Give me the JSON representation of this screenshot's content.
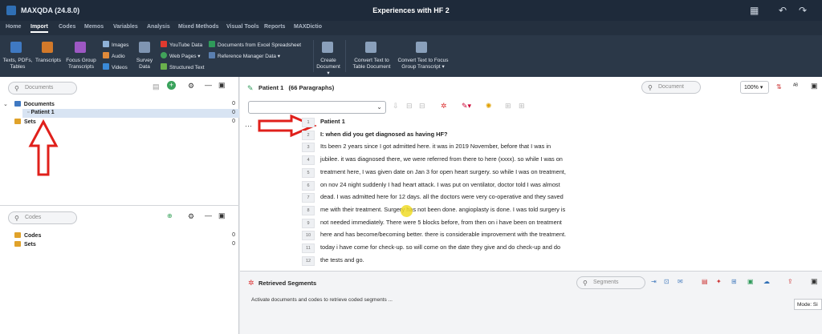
{
  "app": {
    "name": "MAXQDA (24.8.0)",
    "document_title": "Experiences with HF 2"
  },
  "tabs": [
    "Home",
    "Import",
    "Codes",
    "Memos",
    "Variables",
    "Analysis",
    "Mixed Methods",
    "Visual Tools",
    "Reports",
    "MAXDictio"
  ],
  "ribbon": {
    "texts": "Texts, PDFs,",
    "tables": "Tables",
    "transcripts": "Transcripts",
    "focus_group": "Focus Group",
    "focus_group2": "Transcripts",
    "images": "Images",
    "audio": "Audio",
    "videos": "Videos",
    "survey": "Survey",
    "survey2": "Data",
    "youtube": "YouTube Data",
    "webpages": "Web Pages",
    "structured": "Structured Text",
    "excel": "Documents from Excel Spreadsheet",
    "refman": "Reference Manager Data",
    "create_doc": "Create",
    "create_doc2": "Document",
    "convert_table": "Convert Text to",
    "convert_table2": "Table Document",
    "convert_focus": "Convert Text to Focus",
    "convert_focus2": "Group Transcript"
  },
  "documents_panel": {
    "search_placeholder": "Documents",
    "root_label": "Documents",
    "root_count": "0",
    "patient_label": "Patient 1",
    "patient_count": "0",
    "sets_label": "Sets",
    "sets_count": "0"
  },
  "codes_panel": {
    "search_placeholder": "Codes",
    "codes_label": "Codes",
    "codes_count": "0",
    "sets_label": "Sets",
    "sets_count": "0"
  },
  "document_browser": {
    "title": "Patient 1",
    "paragraphs": "(66 Paragraphs)",
    "search_placeholder": "Document",
    "zoom": "100%",
    "lines": [
      {
        "n": "1",
        "text": "Patient 1",
        "bold": true
      },
      {
        "n": "2",
        "text": "I: when did you get diagnosed as having HF?",
        "bold": true
      },
      {
        "n": "3",
        "text": "Its been 2 years since I got admitted here. it was in 2019 November, before that I was in"
      },
      {
        "n": "4",
        "text": "jubilee. it was diagnosed there, we were referred from there to here (xxxx). so while I was on"
      },
      {
        "n": "5",
        "text": "treatment here, I was given date on Jan 3 for open heart surgery. so while I was on treatment,"
      },
      {
        "n": "6",
        "text": "on nov 24 night suddenly I had heart attack. I was put on ventilator, doctor told I was almost"
      },
      {
        "n": "7",
        "text": "dead. I was admitted here for 12 days. all the doctors were very co-operative and they saved"
      },
      {
        "n": "8",
        "text": "me with their treatment. Surgery has not been done. angioplasty is done. I was told surgery is"
      },
      {
        "n": "9",
        "text": "not needed immediately. There were 5 blocks before, from then on i have been on treatment"
      },
      {
        "n": "10",
        "text": "here and has become/becoming better. there is considerable improvement with the treatment."
      },
      {
        "n": "11",
        "text": "today i have come for check-up. so will come on the date they give and do check-up and do"
      },
      {
        "n": "12",
        "text": "the tests and go."
      }
    ]
  },
  "retrieved": {
    "title": "Retrieved Segments",
    "search_placeholder": "Segments",
    "message": "Activate documents and codes to retrieve coded segments ...",
    "mode": "Mode: Si"
  },
  "colors": {
    "titlebar": "#1e2a3a",
    "ribbon": "#2b3848",
    "arrow": "#e0201b",
    "selection": "#d8e4f3"
  }
}
